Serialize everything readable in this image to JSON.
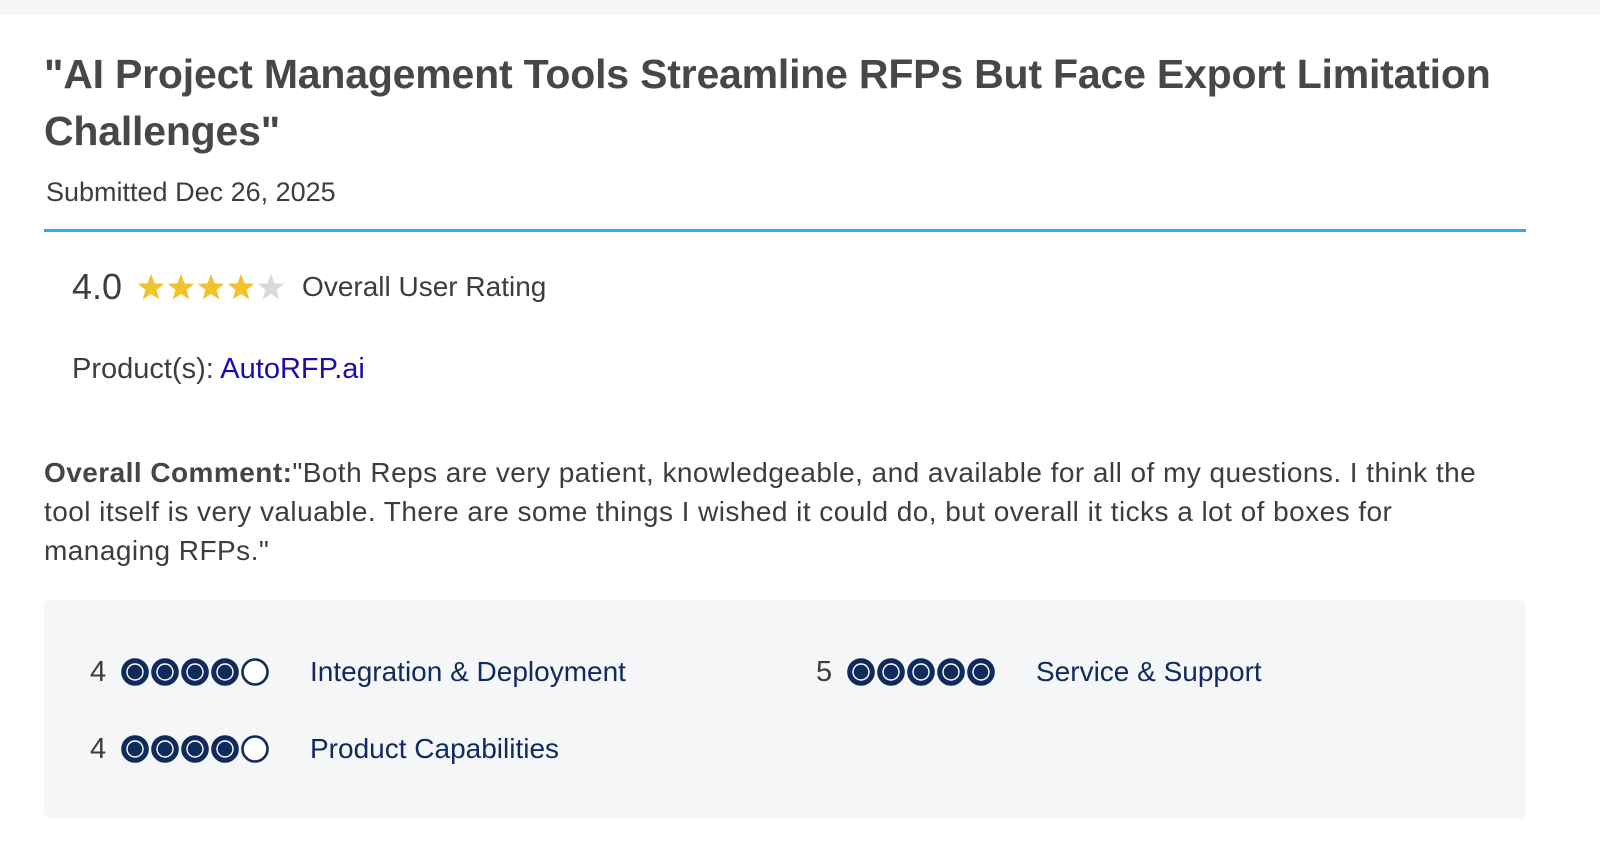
{
  "review": {
    "title": "\"AI Project Management Tools Streamline RFPs But Face Export Limitation Challenges\"",
    "submitted": "Submitted Dec 26, 2025",
    "overall_rating": "4.0",
    "overall_stars": 4,
    "overall_label": "Overall User Rating",
    "product_label": "Product(s):",
    "product_name": "AutoRFP.ai",
    "comment_label": "Overall Comment:",
    "comment_text": "\"Both Reps are very patient, knowledgeable, and available for all of my questions. I think the tool itself is very valuable. There are some things I wished it could do, but overall it ticks a lot of boxes for managing RFPs.\""
  },
  "scores": [
    {
      "value": "4",
      "filled": 4,
      "label": "Integration & Deployment"
    },
    {
      "value": "5",
      "filled": 5,
      "label": "Service & Support"
    },
    {
      "value": "4",
      "filled": 4,
      "label": "Product Capabilities"
    }
  ],
  "colors": {
    "accent_line": "#36a9e1",
    "star_filled": "#f2c12e",
    "star_empty": "#d9d9d9",
    "dot_filled": "#0f2a5c",
    "link": "#1a0dab"
  },
  "icons": {
    "star": "star-icon",
    "score_dot": "rating-dot-icon"
  }
}
